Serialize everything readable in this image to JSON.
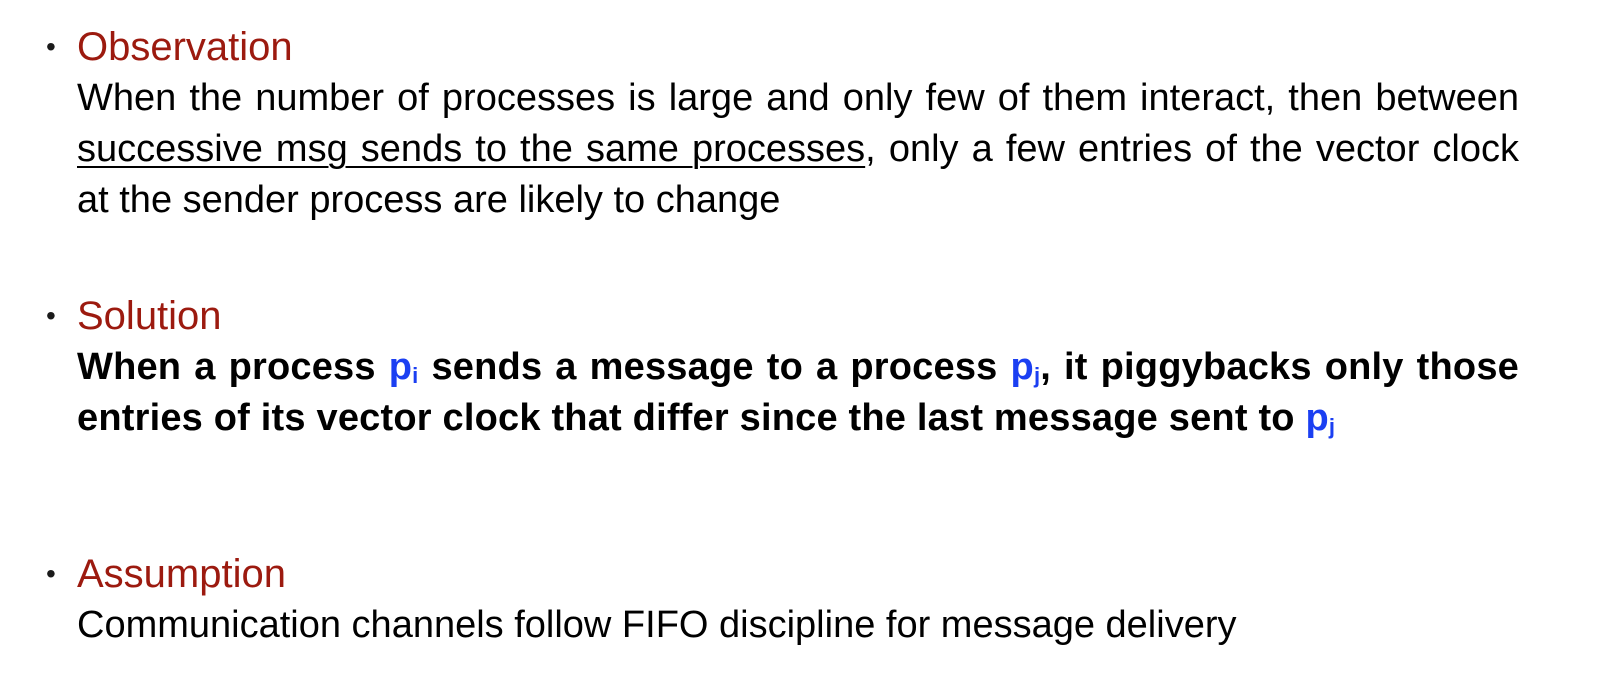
{
  "observation": {
    "title": "Observation",
    "text_1": "When the number of processes is large and only few of them interact, then between ",
    "underlined": "successive msg sends to the same processes",
    "text_2": ", only a few entries of the vector clock at the sender process are likely to change"
  },
  "solution": {
    "title": "Solution",
    "text_1": "When a process ",
    "var_1": "p",
    "var_1_sub": "i",
    "text_2": " sends a message to a process ",
    "var_2": "p",
    "var_2_sub": "j",
    "text_3": ", it piggybacks only those entries of its vector clock that differ since the last message sent to ",
    "var_3": "p",
    "var_3_sub": "j"
  },
  "assumption": {
    "title": "Assumption",
    "text": "Communication channels follow FIFO discipline for message delivery"
  },
  "bullet_glyph": "•",
  "colors": {
    "heading": "#9c1a0f",
    "variable": "#1b3ff2",
    "body": "#000000"
  }
}
